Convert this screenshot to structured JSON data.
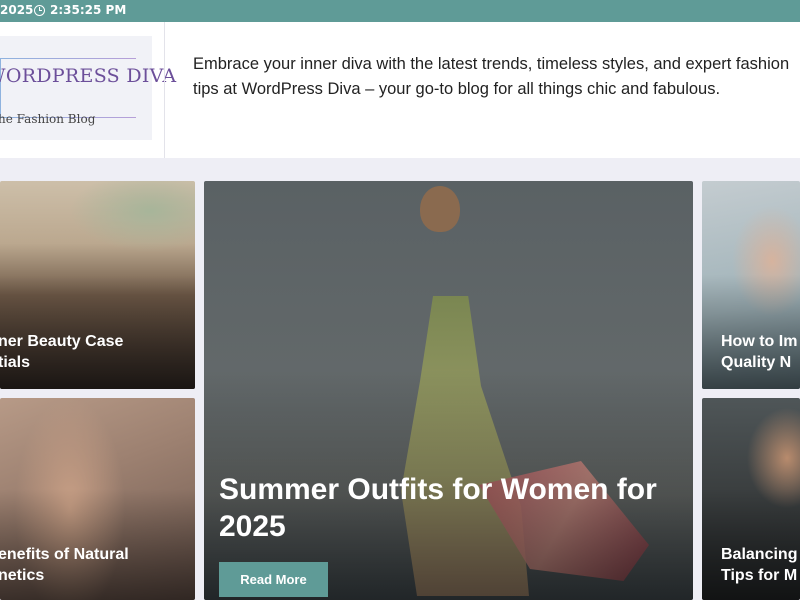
{
  "topbar": {
    "date": "2025",
    "time": "2:35:25 PM"
  },
  "header": {
    "logo_title": "WORDPRESS DIVA",
    "logo_subtitle": "The Fashion Blog",
    "tagline": "Embrace your inner diva with the latest trends, timeless styles, and expert fashion tips at WordPress Diva – your go-to blog for all things chic and fabulous."
  },
  "posts": {
    "left_top_title": "ner Beauty Case\ntials",
    "left_bottom_title": "enefits of Natural\nnetics",
    "featured_title": "Summer Outfits for Women for 2025",
    "featured_button": "Read More",
    "right_top_title": "How to Im\nQuality N",
    "right_bottom_title": "Balancing\nTips for M"
  },
  "colors": {
    "accent": "#5f9b97",
    "background": "#eeeef5",
    "logo_purple": "#6c4f9a"
  }
}
